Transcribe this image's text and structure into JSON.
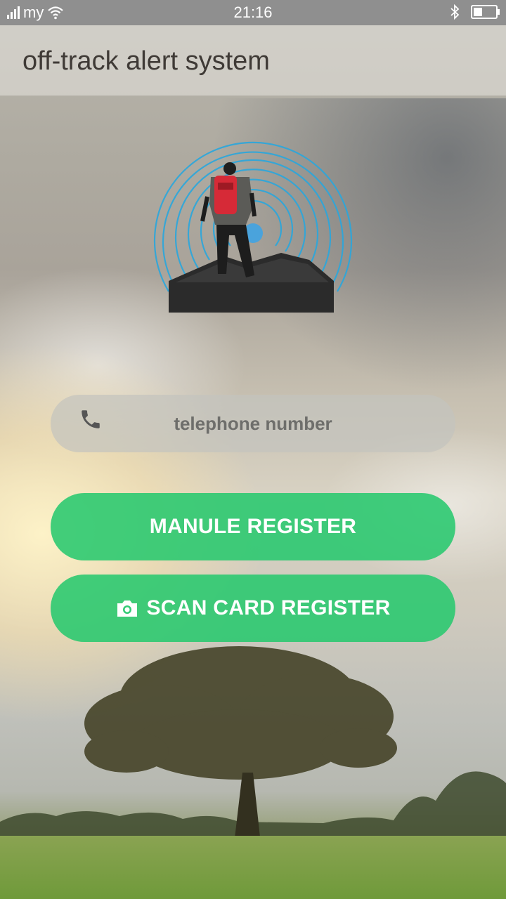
{
  "status_bar": {
    "carrier": "my",
    "time": "21:16",
    "battery_level": 0.35
  },
  "app_bar": {
    "title": "off-track alert system"
  },
  "form": {
    "phone_placeholder": "telephone number",
    "phone_value": ""
  },
  "buttons": {
    "manual_register": "MANULE REGISTER",
    "scan_card_register": "SCAN CARD REGISTER"
  },
  "colors": {
    "button_green": "#28c86e",
    "signal_blue": "#2aa7dd",
    "backpack_red": "#d62a37"
  },
  "icons": {
    "phone": "phone-icon",
    "camera": "camera-icon",
    "wifi": "wifi-icon",
    "bluetooth": "bluetooth-icon",
    "battery": "battery-icon"
  }
}
